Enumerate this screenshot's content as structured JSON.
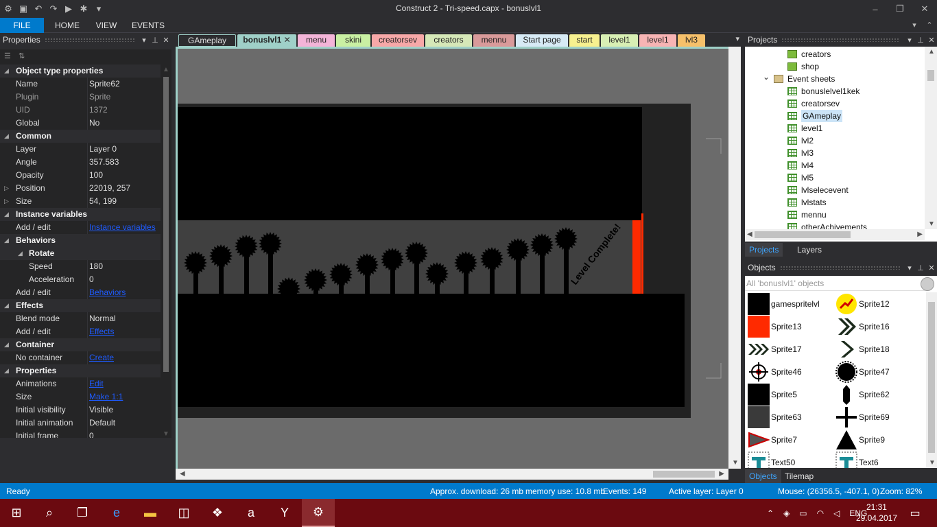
{
  "titlebar": {
    "title": "Construct 2 - Tri-speed.capx - bonuslvl1",
    "minimize": "–",
    "restore": "❐",
    "close": "✕"
  },
  "ribbon": {
    "tabs": [
      "FILE",
      "HOME",
      "VIEW",
      "EVENTS"
    ]
  },
  "properties": {
    "header": "Properties",
    "rows": [
      {
        "type": "cat",
        "name": "Object type properties",
        "expand": "◢"
      },
      {
        "name": "Name",
        "value": "Sprite62"
      },
      {
        "name": "Plugin",
        "value": "Sprite",
        "dim": true
      },
      {
        "name": "UID",
        "value": "1372",
        "dim": true
      },
      {
        "name": "Global",
        "value": "No"
      },
      {
        "type": "cat",
        "name": "Common",
        "expand": "◢"
      },
      {
        "name": "Layer",
        "value": "Layer 0"
      },
      {
        "name": "Angle",
        "value": "357.583"
      },
      {
        "name": "Opacity",
        "value": "100"
      },
      {
        "name": "Position",
        "value": "22019, 257",
        "expand": "▷"
      },
      {
        "name": "Size",
        "value": "54, 199",
        "expand": "▷"
      },
      {
        "type": "cat",
        "name": "Instance variables",
        "expand": "◢"
      },
      {
        "name": "Add / edit",
        "value": "Instance variables",
        "link": true
      },
      {
        "type": "cat",
        "name": "Behaviors",
        "expand": "◢"
      },
      {
        "type": "subcat",
        "name": "Rotate",
        "expand": "◢"
      },
      {
        "type": "sub",
        "name": "Speed",
        "value": "180"
      },
      {
        "type": "sub",
        "name": "Acceleration",
        "value": "0"
      },
      {
        "name": "Add / edit",
        "value": "Behaviors",
        "link": true
      },
      {
        "type": "cat",
        "name": "Effects",
        "expand": "◢"
      },
      {
        "name": "Blend mode",
        "value": "Normal"
      },
      {
        "name": "Add / edit",
        "value": "Effects",
        "link": true
      },
      {
        "type": "cat",
        "name": "Container",
        "expand": "◢"
      },
      {
        "name": "No container",
        "value": "Create",
        "link": true
      },
      {
        "type": "cat",
        "name": "Properties",
        "expand": "◢"
      },
      {
        "name": "Animations",
        "value": "Edit",
        "link": true
      },
      {
        "name": "Size",
        "value": "Make 1:1",
        "link": true
      },
      {
        "name": "Initial visibility",
        "value": "Visible"
      },
      {
        "name": "Initial animation",
        "value": "Default"
      },
      {
        "name": "Initial frame",
        "value": "0"
      }
    ]
  },
  "doctabs": [
    {
      "label": "GAmeplay",
      "color": "#2d2d30",
      "text": "#e0e0e0"
    },
    {
      "label": "bonuslvl1",
      "color": "#9fd0c8",
      "active": true
    },
    {
      "label": "menu",
      "color": "#f3b4d8"
    },
    {
      "label": "skini",
      "color": "#c9f0a3"
    },
    {
      "label": "creatorsev",
      "color": "#f7a8a8"
    },
    {
      "label": "creators",
      "color": "#d6e8b8"
    },
    {
      "label": "mennu",
      "color": "#d99a9a"
    },
    {
      "label": "Start page",
      "color": "#d7eaf5"
    },
    {
      "label": "start",
      "color": "#f7f08f"
    },
    {
      "label": "level1",
      "color": "#d8efb4"
    },
    {
      "label": "level1",
      "color": "#f7b4b4"
    },
    {
      "label": "lvl3",
      "color": "#f6c06a"
    }
  ],
  "canvas": {
    "level_text": "Level Complete!"
  },
  "projects": {
    "header": "Projects",
    "items": [
      {
        "label": "creators",
        "icon": "folder-icon",
        "indent": 1
      },
      {
        "label": "shop",
        "icon": "folder-icon",
        "indent": 1
      },
      {
        "label": "Event sheets",
        "icon": "open-folder-icon",
        "indent": 0,
        "expanded": true
      },
      {
        "label": "bonuslelvel1kek",
        "icon": "event-sheet-icon",
        "indent": 1
      },
      {
        "label": "creatorsev",
        "icon": "event-sheet-icon",
        "indent": 1
      },
      {
        "label": "GAmeplay",
        "icon": "event-sheet-icon",
        "indent": 1,
        "selected": true
      },
      {
        "label": "level1",
        "icon": "event-sheet-icon",
        "indent": 1
      },
      {
        "label": "lvl2",
        "icon": "event-sheet-icon",
        "indent": 1
      },
      {
        "label": "lvl3",
        "icon": "event-sheet-icon",
        "indent": 1
      },
      {
        "label": "lvl4",
        "icon": "event-sheet-icon",
        "indent": 1
      },
      {
        "label": "lvl5",
        "icon": "event-sheet-icon",
        "indent": 1
      },
      {
        "label": "lvlselecevent",
        "icon": "event-sheet-icon",
        "indent": 1
      },
      {
        "label": "lvlstats",
        "icon": "event-sheet-icon",
        "indent": 1
      },
      {
        "label": "mennu",
        "icon": "event-sheet-icon",
        "indent": 1
      },
      {
        "label": "otherAchivements",
        "icon": "event-sheet-icon",
        "indent": 1
      }
    ],
    "tabs": [
      "Projects",
      "Layers"
    ]
  },
  "objects": {
    "header": "Objects",
    "filter_placeholder": "All 'bonuslvl1' objects",
    "items": [
      {
        "label": "gamespritelvl",
        "thumb": "black-square"
      },
      {
        "label": "Sprite12",
        "thumb": "yellow-circle"
      },
      {
        "label": "Sprite13",
        "thumb": "red-square"
      },
      {
        "label": "Sprite16",
        "thumb": "double-chevron"
      },
      {
        "label": "Sprite17",
        "thumb": "triple-chevron"
      },
      {
        "label": "Sprite18",
        "thumb": "single-chevron"
      },
      {
        "label": "Sprite46",
        "thumb": "crosshair"
      },
      {
        "label": "Sprite47",
        "thumb": "sawblade"
      },
      {
        "label": "Sprite5",
        "thumb": "black-square"
      },
      {
        "label": "Sprite62",
        "thumb": "pill"
      },
      {
        "label": "Sprite63",
        "thumb": "grey-square"
      },
      {
        "label": "Sprite69",
        "thumb": "cross"
      },
      {
        "label": "Sprite7",
        "thumb": "arrow-tri"
      },
      {
        "label": "Sprite9",
        "thumb": "triangle"
      },
      {
        "label": "Text50",
        "thumb": "text-t"
      },
      {
        "label": "Text6",
        "thumb": "text-t"
      }
    ],
    "tabs": [
      "Objects",
      "Tilemap"
    ]
  },
  "status": {
    "ready": "Ready",
    "download": "Approx. download: 26 mb",
    "memory": "memory use: 10.8 mb",
    "events": "Events: 149",
    "layer": "Active layer: Layer 0",
    "mouse": "Mouse: (26356.5, -407.1, 0)",
    "zoom": "Zoom: 82%"
  },
  "taskbar": {
    "lang": "ENG",
    "time": "21:31",
    "date": "29.04.2017"
  }
}
